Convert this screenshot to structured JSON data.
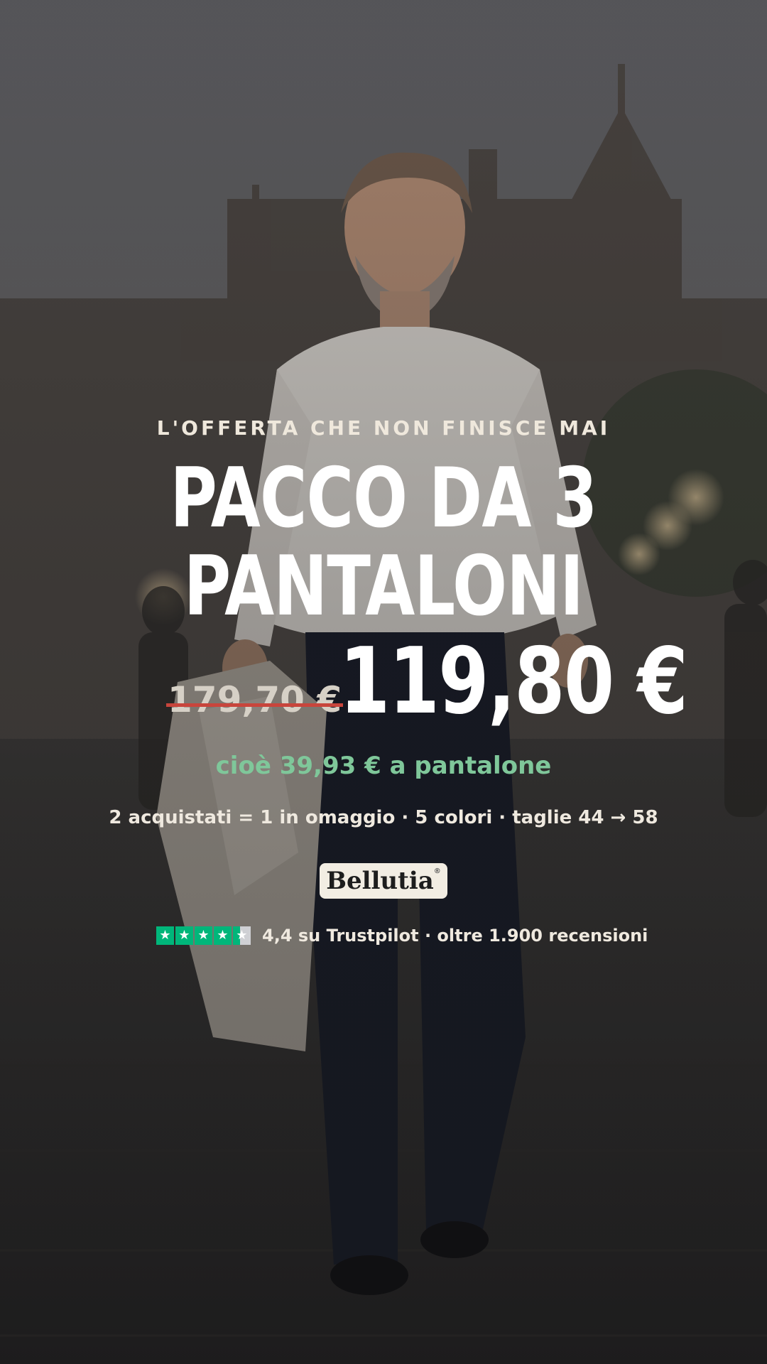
{
  "offer": {
    "eyebrow": "L'OFFERTA CHE NON FINISCE MAI",
    "headline_line1": "PACCO DA 3",
    "headline_line2": "PANTALONI",
    "old_price": "179,70 €",
    "new_price": "119,80 €",
    "per_unit": "cioè 39,93 € a pantalone",
    "features": "2 acquistati = 1 in omaggio · 5 colori · taglie 44 → 58"
  },
  "brand": {
    "name": "Bellutia",
    "registered_mark": "®"
  },
  "rating": {
    "stars_value": 4.4,
    "stars_max": 5,
    "star_glyph": "★",
    "text": "4,4 su Trustpilot · oltre 1.900 recensioni"
  },
  "colors": {
    "accent_green": "#7fc79a",
    "trustpilot_green": "#00b67a",
    "strike_red": "#c8453c",
    "badge_bg": "#f2ede3"
  }
}
